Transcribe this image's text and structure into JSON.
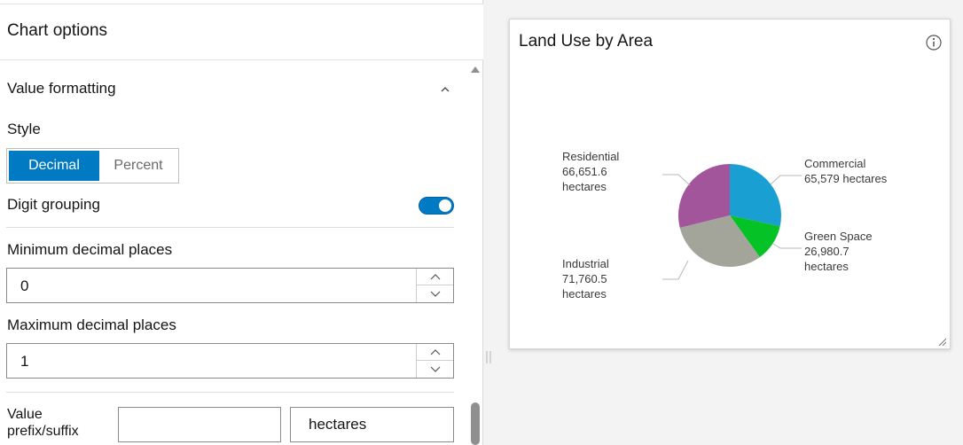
{
  "panel": {
    "title": "Chart options",
    "section_title": "Value formatting",
    "style_label": "Style",
    "style_options": [
      "Decimal",
      "Percent"
    ],
    "style_selected": "Decimal",
    "digit_grouping_label": "Digit grouping",
    "digit_grouping_on": true,
    "min_decimals_label": "Minimum decimal places",
    "min_decimals_value": "0",
    "max_decimals_label": "Maximum decimal places",
    "max_decimals_value": "1",
    "prefix_suffix_label": "Value prefix/suffix",
    "prefix_value": "",
    "suffix_value": "hectares"
  },
  "colors": {
    "accent": "#007ac2",
    "commercial": "#1a9fd3",
    "green_space": "#05c226",
    "industrial": "#a3a49a",
    "residential": "#a2559b"
  },
  "chart_data": {
    "type": "pie",
    "title": "Land Use by Area",
    "unit": "hectares",
    "slices": [
      {
        "name": "Commercial",
        "value": 65579,
        "label": [
          "Commercial",
          "65,579 hectares"
        ],
        "color": "#1a9fd3"
      },
      {
        "name": "Green Space",
        "value": 26980.7,
        "label": [
          "Green Space",
          "26,980.7",
          "hectares"
        ],
        "color": "#05c226"
      },
      {
        "name": "Industrial",
        "value": 71760.5,
        "label": [
          "Industrial",
          "71,760.5",
          "hectares"
        ],
        "color": "#a3a49a"
      },
      {
        "name": "Residential",
        "value": 66651.6,
        "label": [
          "Residential",
          "66,651.6",
          "hectares"
        ],
        "color": "#a2559b"
      }
    ]
  }
}
